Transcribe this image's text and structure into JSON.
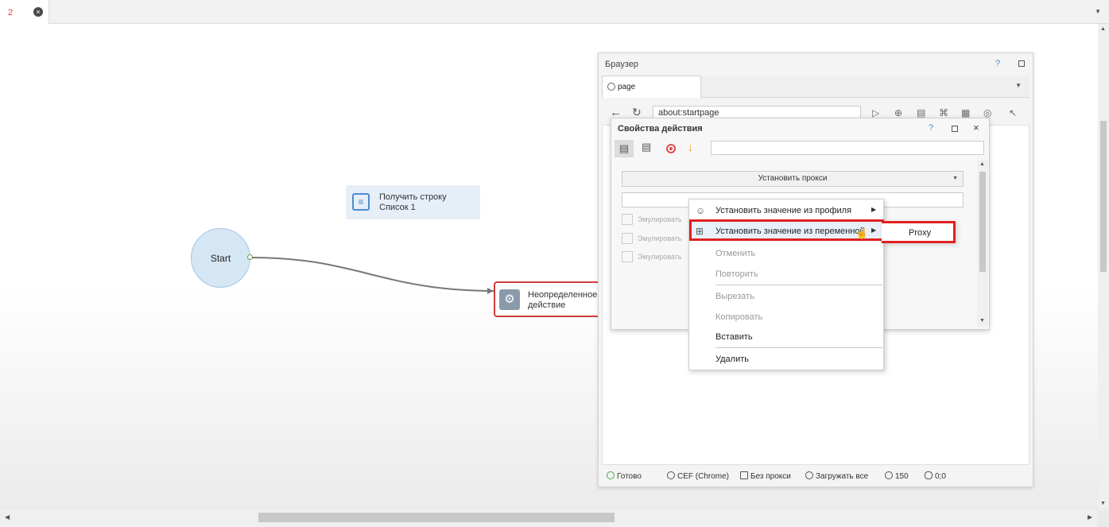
{
  "tabbar": {
    "tab_number": "2",
    "close_glyph": "×",
    "dropdown_glyph": "▼"
  },
  "canvas": {
    "start_node": {
      "label": "Start"
    },
    "list_node": {
      "line1": "Получить строку",
      "line2": "Список 1",
      "icon": "list-icon"
    },
    "undefined_node": {
      "line1": "Неопределенное",
      "line2": "действие",
      "icon": "gear-icon"
    }
  },
  "browser": {
    "title": "Браузер",
    "help": "?",
    "tab_label": "page",
    "tab_icon": "globe-icon",
    "url": "about:startpage",
    "status": {
      "ready": "Готово",
      "engine": "CEF (Chrome)",
      "proxy": "Без прокси",
      "load": "Загружать все",
      "timeout": "150",
      "coords": "0;0"
    }
  },
  "props": {
    "title": "Свойства действия",
    "help": "?",
    "close": "×",
    "select_value": "Установить прокси",
    "checkbox_labels": [
      "Эмулировать г",
      "Эмулировать ч",
      "Эмулировать W"
    ]
  },
  "context_menu": {
    "items": [
      {
        "label": "Установить значение из профиля",
        "icon": "profile-icon",
        "has_submenu": true,
        "enabled": true
      },
      {
        "label": "Установить значение из переменной",
        "icon": "variables-icon",
        "has_submenu": true,
        "enabled": true
      },
      {
        "label": "Отменить",
        "enabled": false
      },
      {
        "label": "Повторить",
        "enabled": false
      },
      {
        "label": "Вырезать",
        "enabled": false
      },
      {
        "label": "Копировать",
        "enabled": false
      },
      {
        "label": "Вставить",
        "enabled": true
      },
      {
        "label": "Удалить",
        "enabled": true
      }
    ],
    "submenu": {
      "item": "Proxy"
    }
  },
  "colors": {
    "highlight": "#e02020",
    "accent": "#4b8bd0",
    "start_fill": "#d5e6f4"
  }
}
